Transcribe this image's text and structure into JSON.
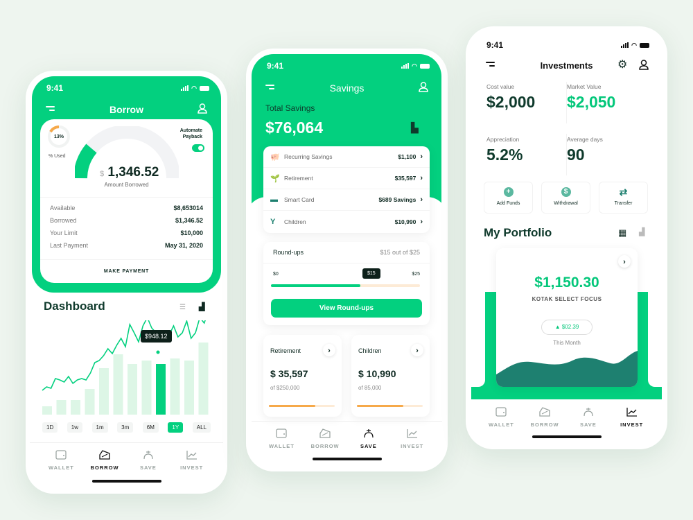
{
  "status_time": "9:41",
  "nav": [
    "WALLET",
    "BORROW",
    "SAVE",
    "INVEST"
  ],
  "borrow": {
    "title": "Borrow",
    "used_pct": "13%",
    "used_label": "% Used",
    "automate": "Automate Payback",
    "automate_on": true,
    "currency": "$",
    "amount": "1,346.52",
    "amount_label": "Amount Borrowed",
    "gauge_fraction": 0.13,
    "rows": [
      {
        "label": "Available",
        "value": "$8,653014"
      },
      {
        "label": "Borrowed",
        "value": "$1,346.52"
      },
      {
        "label": "Your Limit",
        "value": "$10,000"
      },
      {
        "label": "Last Payment",
        "value": "May 31, 2020"
      }
    ],
    "make_payment": "MAKE PAYMENT",
    "dashboard": "Dashboard",
    "tooltip": "$948.12",
    "ranges": [
      "1D",
      "1w",
      "1m",
      "3m",
      "6M",
      "1Y",
      "ALL"
    ],
    "active_range": "1Y",
    "chart_data": {
      "type": "bar",
      "bars": [
        12,
        21,
        21,
        37,
        67,
        87,
        73,
        78,
        73,
        81,
        78,
        104
      ],
      "highlight_index": 8,
      "line": [
        35,
        40,
        38,
        52,
        50,
        47,
        55,
        45,
        50,
        52,
        50,
        60,
        75,
        78,
        85,
        95,
        88,
        100,
        110,
        98,
        130,
        118,
        105,
        128,
        140,
        125,
        118,
        113,
        120,
        115,
        128,
        112,
        118,
        135,
        110,
        118,
        140,
        132,
        150
      ]
    },
    "accent": "#03d07f"
  },
  "savings": {
    "title": "Savings",
    "total_label": "Total Savings",
    "total": "$76,064",
    "items": [
      {
        "label": "Recurring Savings",
        "value": "$1,100",
        "icon": "piggy-bank-icon"
      },
      {
        "label": "Retirement",
        "value": "$35,597",
        "icon": "plant-hand-icon"
      },
      {
        "label": "Smart Card",
        "value": "$689 Savings",
        "icon": "card-icon"
      },
      {
        "label": "Children",
        "value": "$10,990",
        "icon": "child-icon"
      }
    ],
    "roundups": {
      "label": "Round-ups",
      "summary": "$15 out of $25",
      "min": "$0",
      "max": "$25",
      "current": "$15",
      "fraction": 0.6,
      "button": "View Round-ups"
    },
    "goals": [
      {
        "title": "Retirement",
        "amount": "$ 35,597",
        "of": "of $250,000",
        "progress": 0.7
      },
      {
        "title": "Children",
        "amount": "$ 10,990",
        "of": "of 85,000",
        "progress": 0.7
      }
    ]
  },
  "invest": {
    "title": "Investments",
    "stats": [
      {
        "label": "Cost value",
        "value": "$2,000"
      },
      {
        "label": "Market Value",
        "value": "$2,050"
      },
      {
        "label": "Appreciation",
        "value": "5.2%"
      },
      {
        "label": "Average days",
        "value": "90"
      }
    ],
    "actions": [
      {
        "label": "Add Funds",
        "icon": "plus-circle-icon"
      },
      {
        "label": "Withdrawal",
        "icon": "money-bag-icon"
      },
      {
        "label": "Transfer",
        "icon": "transfer-icon"
      }
    ],
    "portfolio": "My Portfolio",
    "fund_value": "$1,150.30",
    "fund_name": "KOTAK SELECT FOCUS",
    "change": "$02.39",
    "period": "This Month"
  }
}
